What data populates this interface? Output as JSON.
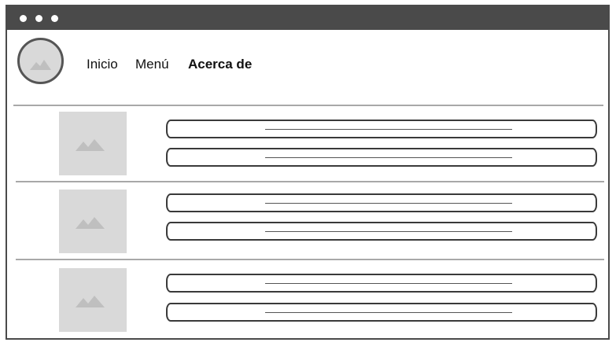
{
  "window": {
    "titlebar_dots": [
      "dot",
      "dot",
      "dot"
    ]
  },
  "logo": {
    "icon": "image-placeholder-icon"
  },
  "nav": {
    "items": [
      {
        "label": "Inicio",
        "active": false
      },
      {
        "label": "Menú",
        "active": false
      },
      {
        "label": "Acerca de",
        "active": true
      }
    ]
  },
  "rows": [
    {
      "thumbnail_icon": "image-placeholder-icon",
      "fields": [
        "",
        ""
      ]
    },
    {
      "thumbnail_icon": "image-placeholder-icon",
      "fields": [
        "",
        ""
      ]
    },
    {
      "thumbnail_icon": "image-placeholder-icon",
      "fields": [
        "",
        ""
      ]
    }
  ],
  "colors": {
    "frame": "#4a4a4a",
    "placeholder": "#d9d9d9",
    "placeholder_mountain": "#bfbfbf",
    "divider": "#a8a8a8"
  }
}
